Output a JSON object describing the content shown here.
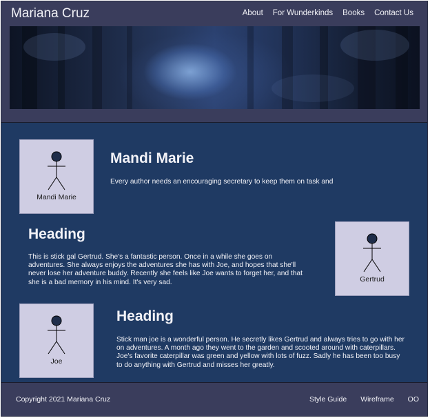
{
  "header": {
    "title": "Mariana Cruz",
    "nav": [
      "About",
      "For Wunderkinds",
      "Books",
      "Contact Us"
    ]
  },
  "banner": {
    "icon": "forest-image"
  },
  "sections": [
    {
      "card_label": "Mandi Marie",
      "heading": "Mandi Marie",
      "text": "Every author needs an encouraging secretary to keep them on task and"
    },
    {
      "card_label": "Gertrud",
      "heading": "Heading",
      "text": "This is stick gal Gertrud. She's a fantastic person. Once in a while she goes on adventures. She always enjoys the adventures she has with Joe, and hopes that she'll never lose her adventure buddy. Recently she feels like Joe wants to forget her, and that she is a bad memory in his mind. It's very sad."
    },
    {
      "card_label": "Joe",
      "heading": "Heading",
      "text": "Stick man joe is a wonderful person. He secretly likes Gertrud and always tries to go with her on adventures. A month ago they went to the garden and scooted around with caterpillars. Joe's favorite caterpillar was green and yellow with lots of fuzz. Sadly he has been too busy to do anything with Gertrud and misses her greatly."
    }
  ],
  "footer": {
    "copyright": "Copyright 2021 Mariana Cruz",
    "links": [
      "Style Guide",
      "Wireframe",
      "OO"
    ]
  },
  "colors": {
    "header_bg": "#3a3d5c",
    "body_bg": "#1f3a63",
    "card_bg": "#cfcde3"
  }
}
